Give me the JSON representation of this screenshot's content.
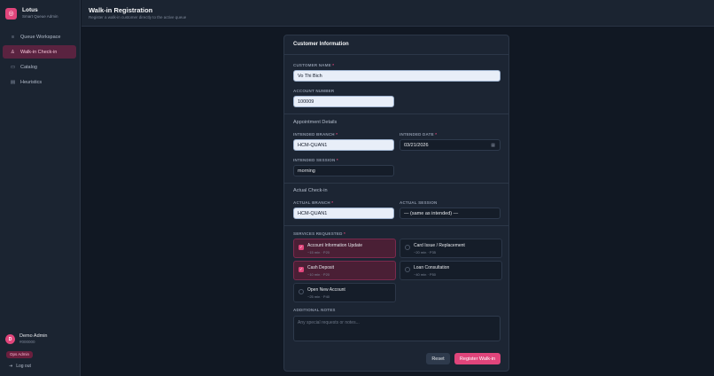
{
  "brand": {
    "title": "Lotus",
    "subtitle": "Smart Queue Admin",
    "logo_letter": "◎"
  },
  "nav": [
    {
      "label": "Queue Workspace",
      "icon": "queue-icon",
      "glyph": "≡",
      "active": false
    },
    {
      "label": "Walk-in Check-in",
      "icon": "person-icon",
      "glyph": "♙",
      "active": true
    },
    {
      "label": "Catalog",
      "icon": "catalog-icon",
      "glyph": "▭",
      "active": false
    },
    {
      "label": "Heuristics",
      "icon": "heuristics-icon",
      "glyph": "▤",
      "active": false
    }
  ],
  "user": {
    "name": "Demo Admin",
    "id": "#000000",
    "avatar_letter": "D",
    "role": "Ops Admin",
    "logout": "Log out"
  },
  "header": {
    "title": "Walk-in Registration",
    "subtitle": "Register a walk-in customer directly to the active queue"
  },
  "form": {
    "title": "Customer Information",
    "customer_name_label": "CUSTOMER NAME",
    "customer_name": "Vo Thi Bich",
    "account_number_label": "ACCOUNT NUMBER",
    "account_number": "100009",
    "appointment_section": "Appointment Details",
    "intended_branch_label": "INTENDED BRANCH",
    "intended_branch": "HCM-QUAN1",
    "intended_date_label": "INTENDED DATE",
    "intended_date": "03/21/2026",
    "intended_session_label": "INTENDED SESSION",
    "intended_session": "morning",
    "actual_section": "Actual Check-in",
    "actual_branch_label": "ACTUAL BRANCH",
    "actual_branch": "HCM-QUAN1",
    "actual_session_label": "ACTUAL SESSION",
    "actual_session": "— (same as intended) —",
    "services_label": "SERVICES REQUESTED",
    "services": [
      {
        "name": "Account Information Update",
        "meta": "~15 min · P20",
        "checked": true
      },
      {
        "name": "Card Issue / Replacement",
        "meta": "~20 min · P35",
        "checked": false
      },
      {
        "name": "Cash Deposit",
        "meta": "~10 min · P20",
        "checked": true
      },
      {
        "name": "Loan Consultation",
        "meta": "~40 min · P50",
        "checked": false
      },
      {
        "name": "Open New Account",
        "meta": "~25 min · P40",
        "checked": false
      }
    ],
    "notes_label": "ADDITIONAL NOTES",
    "notes_placeholder": "Any special requests or notes...",
    "reset_label": "Reset",
    "submit_label": "Register Walk-in",
    "required_mark": "*"
  },
  "colors": {
    "accent": "#e0457b",
    "background": "#111823",
    "card": "#1c2533"
  }
}
